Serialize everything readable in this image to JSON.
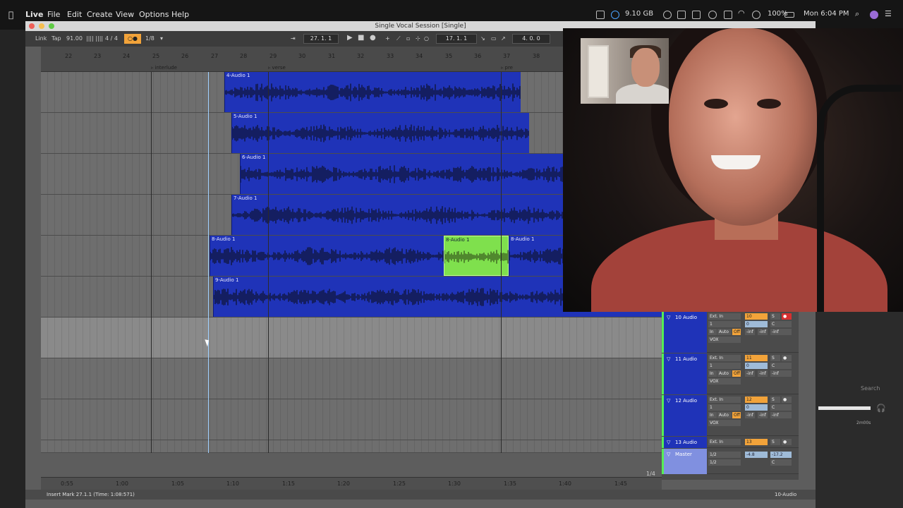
{
  "menubar": {
    "app_name": "Live",
    "items": [
      "File",
      "Edit",
      "Create",
      "View",
      "Options",
      "Help"
    ],
    "storage": "9.10 GB",
    "battery": "100%",
    "clock": "Mon 6:04 PM"
  },
  "window": {
    "title": "Single Vocal Session  [Single]"
  },
  "controlbar": {
    "link": "Link",
    "tap": "Tap",
    "tempo": "91.00",
    "signature": "4 / 4",
    "metro": "○●",
    "quant": "1/8",
    "position": "27.   1.   1",
    "loop_start": "17.   1.   1",
    "loop_length": "4.   0.   0"
  },
  "ruler": {
    "bars": [
      "22",
      "23",
      "24",
      "25",
      "26",
      "27",
      "28",
      "29",
      "30",
      "31",
      "32",
      "33",
      "34",
      "35",
      "36",
      "37",
      "38"
    ],
    "locators": [
      "interlude",
      "verse",
      "pre"
    ]
  },
  "clips": {
    "c4": "4-Audio 1",
    "c5": "5-Audio 1",
    "c6": "6-Audio 1",
    "c7": "7-Audio 1",
    "c8a": "8-Audio 1",
    "c8b": "8-Audio 1",
    "c8c": "8-Audio 1",
    "c9": "9-Audio 1"
  },
  "mixer": {
    "tracks": [
      {
        "name": "10 Audio",
        "input": "Ext. In",
        "ch": "1",
        "num": "10",
        "vol": "0",
        "pan": "C",
        "monitor": [
          "In",
          "Auto",
          "Off"
        ],
        "out": "VOX",
        "inf": "-inf"
      },
      {
        "name": "11 Audio",
        "input": "Ext. In",
        "ch": "1",
        "num": "11",
        "vol": "0",
        "pan": "C",
        "monitor": [
          "In",
          "Auto",
          "Off"
        ],
        "out": "VOX",
        "inf": "-inf"
      },
      {
        "name": "12 Audio",
        "input": "Ext. In",
        "ch": "1",
        "num": "12",
        "vol": "0",
        "pan": "C",
        "monitor": [
          "In",
          "Auto",
          "Off"
        ],
        "out": "VOX",
        "inf": "-inf"
      },
      {
        "name": "13 Audio",
        "input": "Ext. In",
        "num": "13"
      }
    ],
    "master": {
      "name": "Master",
      "out1": "1/2",
      "out2": "1/2",
      "vol": "-4.8",
      "peak": "-17.2",
      "pan": "C"
    },
    "solo": "S",
    "page": "1/4"
  },
  "timeruler": {
    "labels": [
      "0:55",
      "1:00",
      "1:05",
      "1:10",
      "1:15",
      "1:20",
      "1:25",
      "1:30",
      "1:35",
      "1:40",
      "1:45"
    ]
  },
  "statusbar": {
    "message": "Insert Mark 27.1.1 (Time: 1:08:571)",
    "track": "10-Audio"
  },
  "browser": {
    "search_placeholder": "Search",
    "time": "2m00s"
  }
}
